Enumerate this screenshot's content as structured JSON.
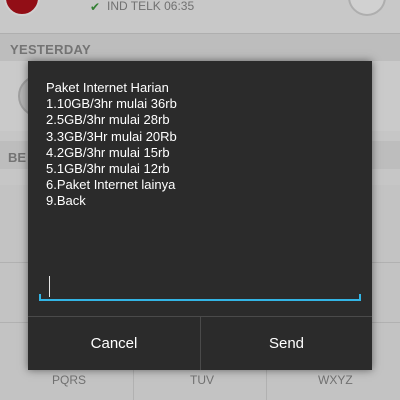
{
  "background": {
    "recent_call": {
      "carrier_time": "IND TELK 06:35"
    },
    "section_yesterday": "YESTERDAY",
    "section_two_label": "BE",
    "dialpad_keys": [
      "PQRS",
      "TUV",
      "WXYZ"
    ]
  },
  "dialog": {
    "message_lines": [
      "Paket Internet Harian",
      "1.10GB/3hr mulai 36rb",
      "2.5GB/3hr mulai 28rb",
      "3.3GB/3Hr mulai 20Rb",
      "4.2GB/3hr mulai 15rb",
      "5.1GB/3hr mulai 12rb",
      "6.Paket Internet lainya",
      "9.Back"
    ],
    "reply_input": {
      "value": "",
      "placeholder": ""
    },
    "cancel_label": "Cancel",
    "send_label": "Send"
  },
  "colors": {
    "dialog_bg": "#2b2b2b",
    "accent": "#33b5e5",
    "text": "#ffffff"
  },
  "icons": {
    "call_type": "outgoing-call-icon",
    "call_button": "phone-icon"
  }
}
